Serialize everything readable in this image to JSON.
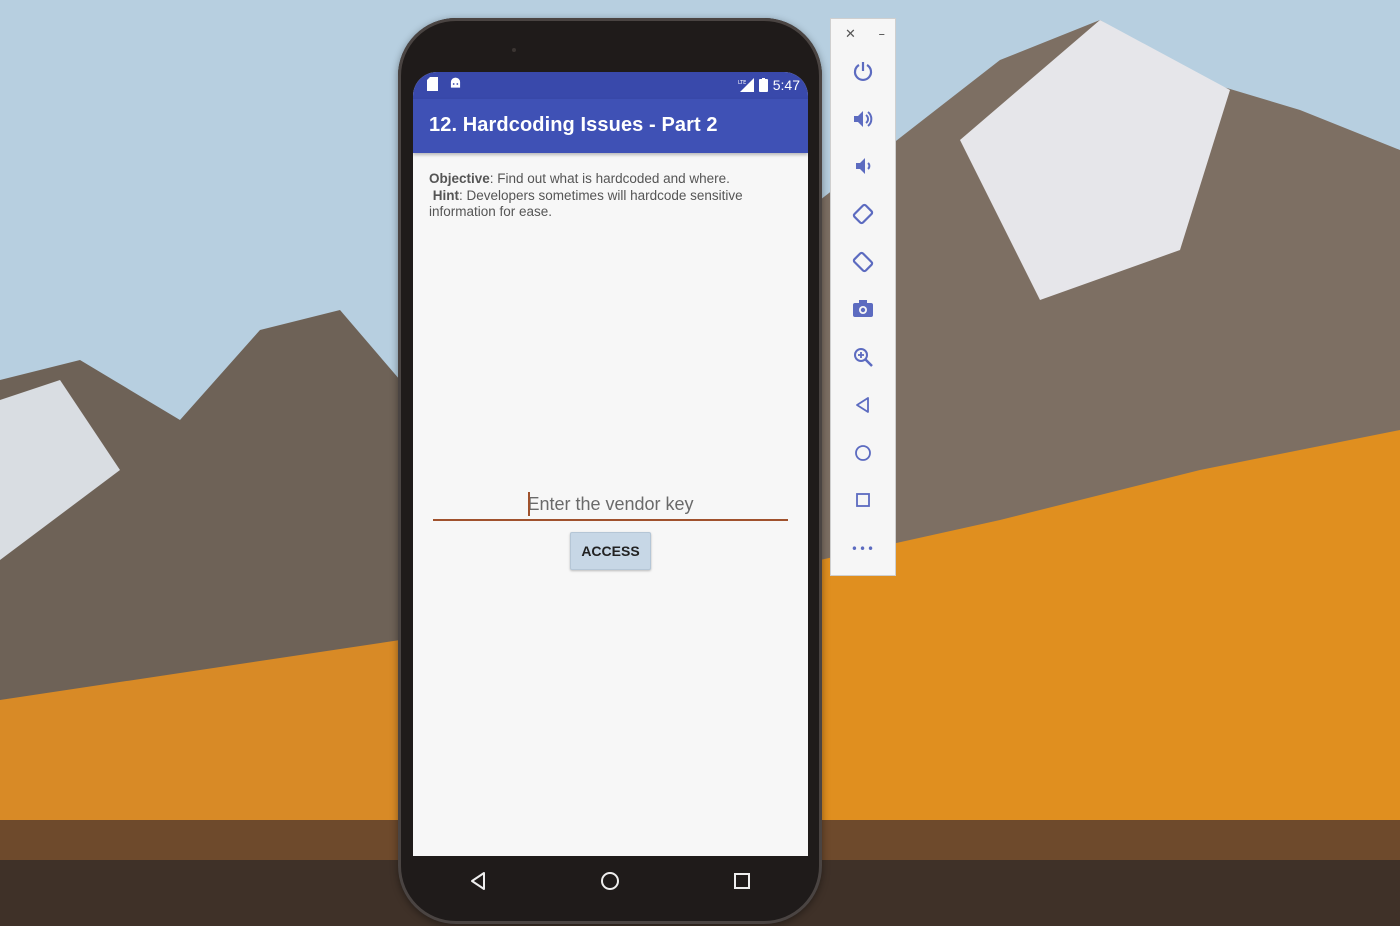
{
  "app": {
    "status_time": "5:47",
    "title": "12. Hardcoding Issues - Part 2"
  },
  "info": {
    "objective_label": "Objective",
    "objective_text": ": Find out what is hardcoded and where.",
    "hint_label": "Hint",
    "hint_text": ": Developers sometimes will hardcode sensitive information for ease."
  },
  "form": {
    "placeholder": "Enter the vendor key",
    "value": "",
    "button_label": "ACCESS"
  },
  "toolbar": {
    "close_label": "✕",
    "minimize_label": "–",
    "more_label": "•••"
  },
  "colors": {
    "status_bar": "#3949ab",
    "app_bar": "#3f51b5",
    "input_underline": "#a0522d",
    "toolbar_icon": "#5c6bc0"
  }
}
